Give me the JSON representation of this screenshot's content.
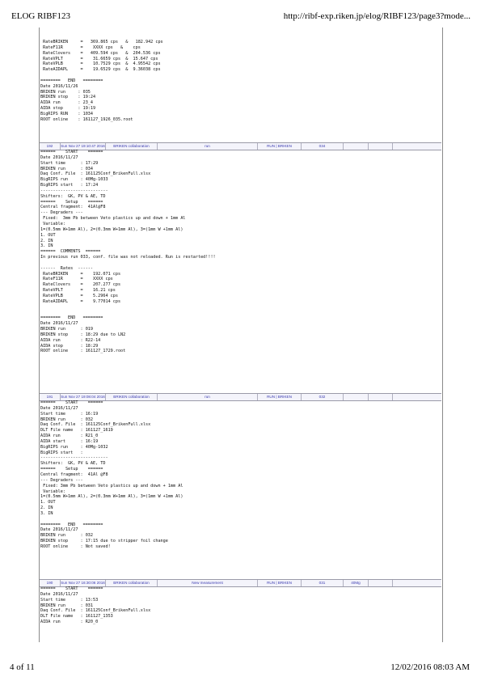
{
  "page_header": {
    "title": "ELOG RIBF123",
    "url": "http://ribf-exp.riken.jp/elog/RIBF123/page3?mode..."
  },
  "page_footer": {
    "page": "4 of 11",
    "datetime": "12/02/2016 08:03 AM"
  },
  "blocks": [
    {
      "lines": [
        " RateBRIKEN     =   369.865 cps   &   182.942 cps",
        " RateF11R       =    XXXX cps   &    cps",
        " RateClovers    =   409.594 cps   &  204.536 cps",
        " RateVPLT       =    31.6659 cps  &  15.647 cps",
        " RateVPLB       =    10.7529 cps  &  4.95542 cps",
        " RateAIDAPL     =    19.6529 cps  &  9.36038 cps",
        "",
        "========   END   ========",
        "Date 2016/11/26",
        "BRIKEN run     : 035",
        "BRIKEN stop    : 19:24",
        "AIDA run       : 23_4",
        "AIDA stop      : 19:19",
        "BigRIPS RUN    : 1034",
        "ROOT online    : 161127_1926_035.root"
      ]
    },
    {
      "lines": [
        "======    START    ======",
        "Date 2016/11/27",
        "Start time      : 17:29",
        "BRIKEN run      : 034",
        "Daq Conf. File  : 161125Conf_BrikenFull.xlsx",
        "BigRIPS run     : 40Mg-1033",
        "BigRIPS start   : 17:24",
        "---------------------------",
        "Shifters:  GK, PV & AE, TD",
        "======    Setup    ======",
        "Central fragment:  41Al@F8",
        "--- Degraders ---",
        " Fixed:  3mm Pb between Veto plastics up and down + 1mm Al",
        " Variable:",
        "1=(0.5mm W+1mm Al), 2=(0.3mm W+1mm Al), 3=(1mm W +1mm Al)",
        "1. OUT",
        "2. IN",
        "3. IN",
        "======  COMMENTS  ======",
        "In previous run 033, conf. file was not reloaded. Run is restarted!!!!",
        "",
        "------  Rates  ------",
        " RateBRIKEN     =    192.071 cps",
        " RateF11R       =    XXXX cps",
        " RateClovers    =    207.277 cps",
        " RateVPLT       =    16.21 cps",
        " RateVPLB       =    5.2964 cps",
        " RateAIDAPL     =    9.77014 cps",
        "",
        "",
        "========   END   ========",
        "Date 2016/11/27",
        "BRIKEN run      : 019",
        "BRIKEN stop     : 18:29 due to LN2",
        "AIDA run        : R22-14",
        "AIDA stop       : 18:29",
        "ROOT online     : 161127_1729.root"
      ]
    },
    {
      "lines": [
        "======    START    ======",
        "Date 2016/11/27",
        "Start time      : 16:19",
        "BRIKEN run      : 032",
        "Daq Conf. File  : 161125Conf_BrikenFull.xlsx",
        "DLT File name   : 161127_1619",
        "AIDA run        : R21_0",
        "AIDA start      : 16:19",
        "BigRIPS run     : 40Mg-1032",
        "BigRIPS start   :",
        "---------------------------",
        "Shifters:  GK, PV & AE, TD",
        "======    Setup    ======",
        "Central fragment:  41Al @F8",
        "--- Degraders ---",
        " Fixed: 3mm Pb between Veto plastics up and down + 1mm Al",
        " Variable:",
        "1=(0.5mm W+1mm Al), 2=(0.3mm W+1mm Al), 3=(1mm W +1mm Al)",
        "1. OUT",
        "2. IN",
        "3. IN",
        "",
        "========   END   ========",
        "Date 2016/11/27",
        "BRIKEN run      : 032",
        "BRIKEN stop     : 17:15 due to stripper foil change",
        "ROOT online     : Not saved!"
      ]
    },
    {
      "lines": [
        "======    START    ======",
        "Date 2016/11/27",
        "Start time      : 13:53",
        "BRIKEN run      : 031",
        "Daq Conf. File  : 161125Conf_BrikenFull.xlsx",
        "DLT File name   : 161127_1353",
        "AIDA run        : R20_0"
      ]
    }
  ],
  "entry_rows": [
    {
      "id": "192",
      "date": "Sun Nov 27 19:10:47 2016",
      "author": "BRIKEN collaboration",
      "subject": "run",
      "category": "RUN | BRIKEN",
      "run": "034",
      "extra": ""
    },
    {
      "id": "191",
      "date": "Sun Nov 27 19:08:04 2016",
      "author": "BRIKEN collaboration",
      "subject": "run",
      "category": "RUN | BRIKEN",
      "run": "032",
      "extra": ""
    },
    {
      "id": "190",
      "date": "Sun Nov 27 16:30:06 2016",
      "author": "BRIKEN collaboration",
      "subject": "New measurement",
      "category": "RUN | BRIKEN",
      "run": "031",
      "extra": "40Mg"
    }
  ]
}
